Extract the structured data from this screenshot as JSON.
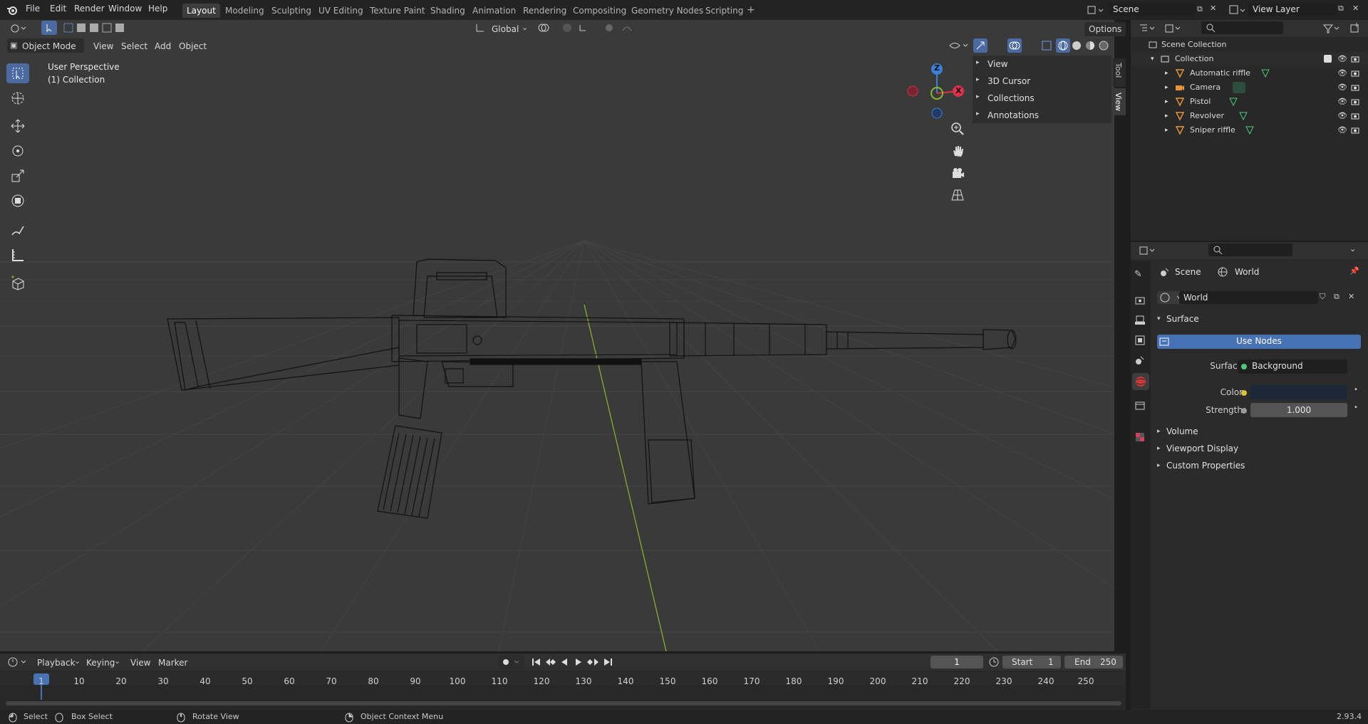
{
  "menu": [
    "File",
    "Edit",
    "Render",
    "Window",
    "Help"
  ],
  "workspaces": [
    "Layout",
    "Modeling",
    "Sculpting",
    "UV Editing",
    "Texture Paint",
    "Shading",
    "Animation",
    "Rendering",
    "Compositing",
    "Geometry Nodes",
    "Scripting"
  ],
  "active_workspace": "Layout",
  "scene_field": "Scene",
  "view_layer_field": "View Layer",
  "viewport": {
    "mode": "Object Mode",
    "menus": [
      "View",
      "Select",
      "Add",
      "Object"
    ],
    "orientation": "Global",
    "options": "Options",
    "overlay_title": "User Perspective",
    "overlay_sub": "(1) Collection",
    "axis_z": "Z",
    "axis_x": "X",
    "npanel_items": [
      "View",
      "3D Cursor",
      "Collections",
      "Annotations"
    ],
    "npanel_tabs": [
      "Tool",
      "View"
    ]
  },
  "outliner": {
    "root": "Scene Collection",
    "collection": "Collection",
    "items": [
      "Automatic riffle",
      "Camera",
      "Pistol",
      "Revolver",
      "Sniper riffle"
    ]
  },
  "properties": {
    "crumb_scene": "Scene",
    "crumb_world": "World",
    "world_name": "World",
    "surface_header": "Surface",
    "use_nodes": "Use Nodes",
    "surface_label": "Surface",
    "surface_value": "Background",
    "color_label": "Color",
    "strength_label": "Strength",
    "strength_value": "1.000",
    "collapsed": [
      "Volume",
      "Viewport Display",
      "Custom Properties"
    ],
    "color_swatch": "#1c2838"
  },
  "timeline": {
    "menus": [
      "Playback",
      "Keying",
      "View",
      "Marker"
    ],
    "current_frame": "1",
    "start_label": "Start",
    "start_value": "1",
    "end_label": "End",
    "end_value": "250",
    "ticks": [
      "1",
      "10",
      "20",
      "30",
      "40",
      "50",
      "60",
      "70",
      "80",
      "90",
      "100",
      "110",
      "120",
      "130",
      "140",
      "150",
      "160",
      "170",
      "180",
      "190",
      "200",
      "210",
      "220",
      "230",
      "240",
      "250"
    ]
  },
  "status": {
    "select": "Select",
    "box_select": "Box Select",
    "rotate_view": "Rotate View",
    "context_menu": "Object Context Menu",
    "version": "2.93.4"
  },
  "colors": {
    "accent": "#4772b3",
    "active_tool": "#4a6aa0",
    "green_axis": "#8bb82a"
  }
}
